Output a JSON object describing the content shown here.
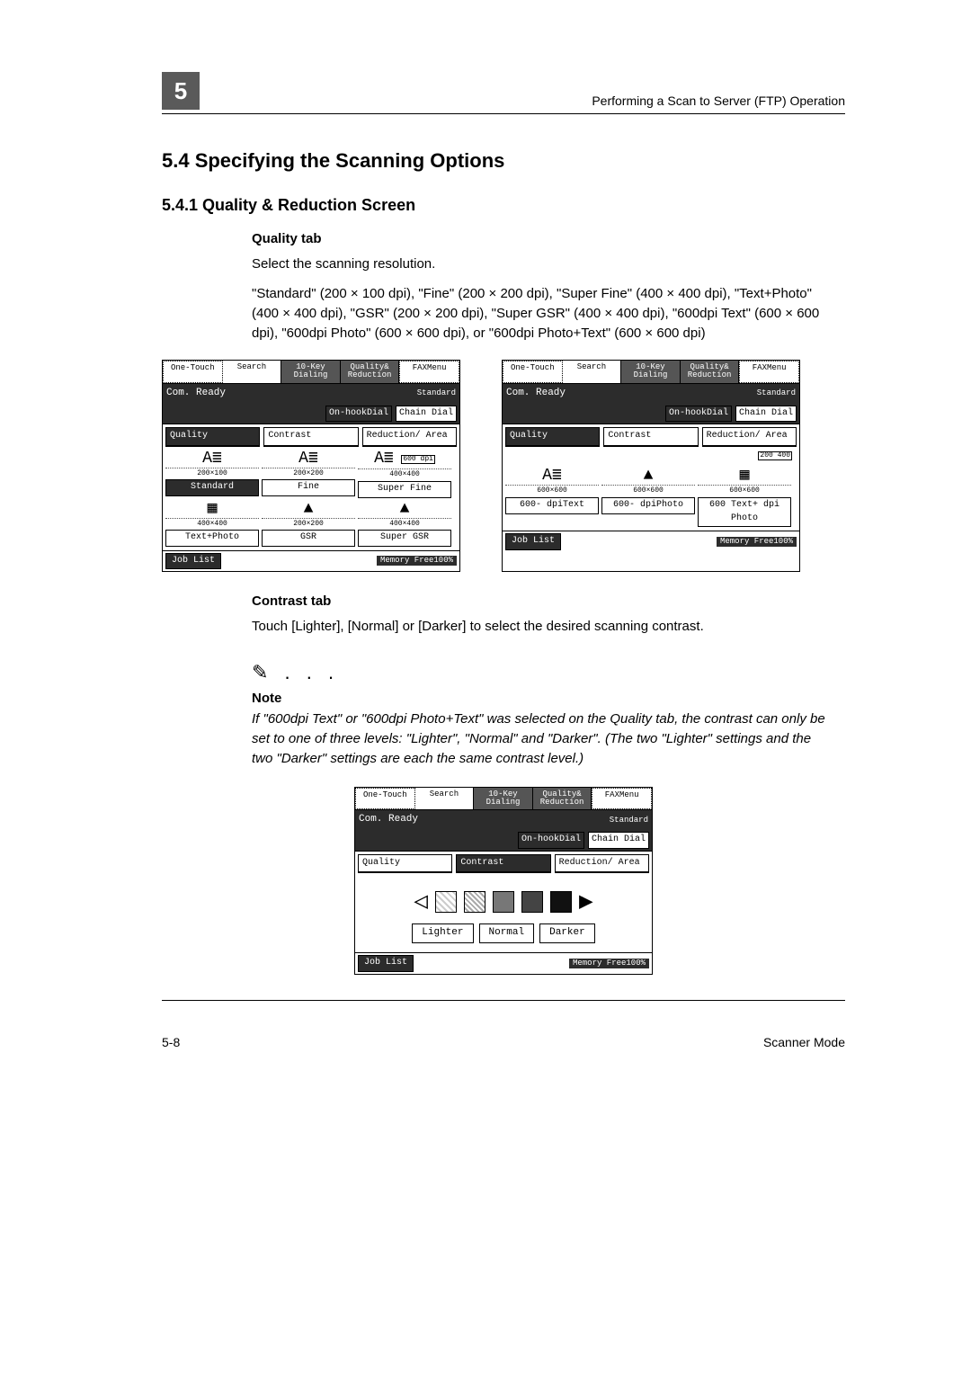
{
  "header": {
    "chapter_number": "5",
    "running_title": "Performing a Scan to Server (FTP) Operation"
  },
  "section": {
    "number_title": "5.4    Specifying the Scanning Options",
    "sub_number_title": "5.4.1   Quality & Reduction Screen"
  },
  "quality": {
    "heading": "Quality tab",
    "line1": "Select the scanning resolution.",
    "line2": "\"Standard\" (200 × 100 dpi), \"Fine\" (200 × 200 dpi), \"Super Fine\" (400 × 400 dpi), \"Text+Photo\" (400 × 400 dpi), \"GSR\" (200 × 200 dpi), \"Super GSR\" (400 × 400 dpi), \"600dpi Text\" (600 × 600 dpi), \"600dpi Photo\" (600 × 600 dpi), or \"600dpi Photo+Text\" (600 × 600 dpi)"
  },
  "lcd_common": {
    "tabs": [
      "One-Touch",
      "Search",
      "10-Key\nDialing",
      "Quality&\nReduction",
      "FAXMenu"
    ],
    "bar_status": "Com. Ready",
    "bar_mode": "Standard",
    "bar_pill1": "On-hookDial",
    "bar_pill2": "Chain Dial",
    "subtabs": [
      "Quality",
      "Contrast",
      "Reduction/\nArea"
    ],
    "joblist": "Job List",
    "memory": "Memory\nFree100%"
  },
  "panel_quality_left": {
    "opts": [
      {
        "icon": "A≣",
        "sub": "200×100",
        "label": "Standard",
        "dark": true
      },
      {
        "icon": "A≣",
        "sub": "200×200",
        "label": "Fine"
      },
      {
        "icon": "A≣",
        "sub": "400×400",
        "label": "Super Fine",
        "chip": "600\ndpi"
      },
      {
        "icon": "▦",
        "sub": "400×400",
        "label": "Text+Photo"
      },
      {
        "icon": "▲",
        "sub": "200×200",
        "label": "GSR"
      },
      {
        "icon": "▲",
        "sub": "400×400",
        "label": "Super GSR"
      }
    ]
  },
  "panel_quality_right": {
    "chip": "200\n400",
    "opts": [
      {
        "icon": "A≣",
        "sub": "600×600",
        "label": "600-\ndpiText"
      },
      {
        "icon": "▲",
        "sub": "600×600",
        "label": "600-\ndpiPhoto"
      },
      {
        "icon": "▦",
        "sub": "600×600",
        "label": "600 Text+\ndpi   Photo"
      }
    ]
  },
  "contrast": {
    "heading": "Contrast tab",
    "body": "Touch [Lighter], [Normal] or [Darker] to select the desired scanning contrast."
  },
  "note": {
    "icon": "✎ . . .",
    "heading": "Note",
    "body": "If \"600dpi Text\" or \"600dpi Photo+Text\" was selected on the Quality tab, the contrast can only be set to one of three levels: \"Lighter\", \"Normal\" and \"Darker\". (The two \"Lighter\" settings and the two \"Darker\" settings are each the same contrast level.)"
  },
  "panel_contrast": {
    "btns": [
      "Lighter",
      "Normal",
      "Darker"
    ]
  },
  "footer": {
    "left": "5-8",
    "right": "Scanner Mode"
  }
}
